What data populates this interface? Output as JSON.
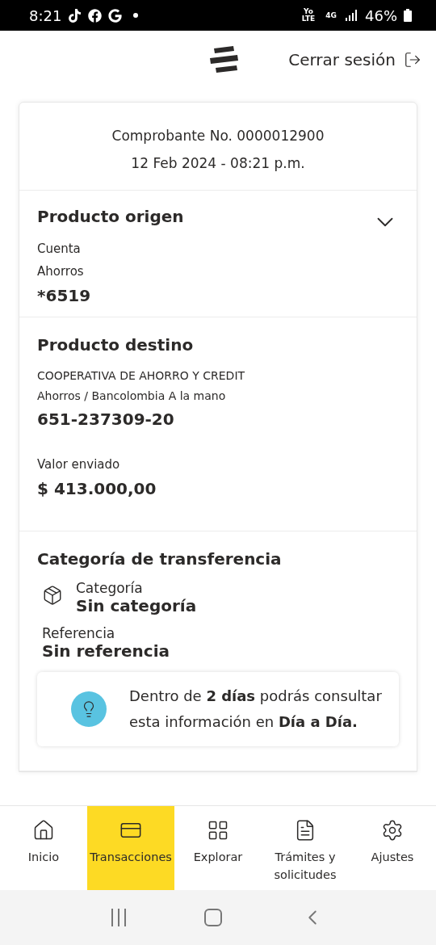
{
  "status_bar": {
    "time": "8:21",
    "battery": "46%",
    "volte": "Yo LTE",
    "network": "4G"
  },
  "header": {
    "logout": "Cerrar sesión"
  },
  "receipt": {
    "number": "Comprobante No. 0000012900",
    "date": "12 Feb 2024 - 08:21 p.m."
  },
  "origin": {
    "title": "Producto origen",
    "expanded": false,
    "lines": [
      "Cuenta",
      "Ahorros"
    ],
    "account": "*6519"
  },
  "destination": {
    "title": "Producto destino",
    "lines": [
      "COOPERATIVA DE AHORRO Y CREDIT",
      "Ahorros / Bancolombia A la mano"
    ],
    "account": "651-237309-20",
    "amount_label": "Valor enviado",
    "amount": "$ 413.000,00"
  },
  "category": {
    "title": "Categoría de transferencia",
    "category_label": "Categoría",
    "category_value": "Sin categoría",
    "reference_label": "Referencia",
    "reference_value": "Sin referencia",
    "tip": "Dentro de **2 días** podrás consultar esta información en **Día a Día.**"
  },
  "nav": [
    {
      "label": "Inicio",
      "kind": "home",
      "selected": false
    },
    {
      "label": "Transacciones",
      "kind": "transactions",
      "selected": true
    },
    {
      "label": "Explorar",
      "kind": "explore",
      "selected": false
    },
    {
      "label": "Trámites y solicitudes",
      "kind": "requests",
      "selected": false
    },
    {
      "label": "Ajustes",
      "kind": "settings",
      "selected": false
    }
  ]
}
